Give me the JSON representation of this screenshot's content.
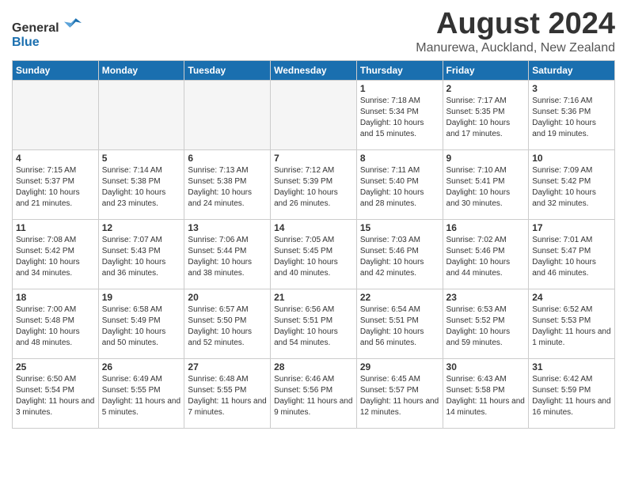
{
  "header": {
    "logo_general": "General",
    "logo_blue": "Blue",
    "month": "August 2024",
    "location": "Manurewa, Auckland, New Zealand"
  },
  "weekdays": [
    "Sunday",
    "Monday",
    "Tuesday",
    "Wednesday",
    "Thursday",
    "Friday",
    "Saturday"
  ],
  "weeks": [
    [
      {
        "day": "",
        "empty": true
      },
      {
        "day": "",
        "empty": true
      },
      {
        "day": "",
        "empty": true
      },
      {
        "day": "",
        "empty": true
      },
      {
        "day": "1",
        "sunrise": "7:18 AM",
        "sunset": "5:34 PM",
        "daylight": "10 hours and 15 minutes."
      },
      {
        "day": "2",
        "sunrise": "7:17 AM",
        "sunset": "5:35 PM",
        "daylight": "10 hours and 17 minutes."
      },
      {
        "day": "3",
        "sunrise": "7:16 AM",
        "sunset": "5:36 PM",
        "daylight": "10 hours and 19 minutes."
      }
    ],
    [
      {
        "day": "4",
        "sunrise": "7:15 AM",
        "sunset": "5:37 PM",
        "daylight": "10 hours and 21 minutes."
      },
      {
        "day": "5",
        "sunrise": "7:14 AM",
        "sunset": "5:38 PM",
        "daylight": "10 hours and 23 minutes."
      },
      {
        "day": "6",
        "sunrise": "7:13 AM",
        "sunset": "5:38 PM",
        "daylight": "10 hours and 24 minutes."
      },
      {
        "day": "7",
        "sunrise": "7:12 AM",
        "sunset": "5:39 PM",
        "daylight": "10 hours and 26 minutes."
      },
      {
        "day": "8",
        "sunrise": "7:11 AM",
        "sunset": "5:40 PM",
        "daylight": "10 hours and 28 minutes."
      },
      {
        "day": "9",
        "sunrise": "7:10 AM",
        "sunset": "5:41 PM",
        "daylight": "10 hours and 30 minutes."
      },
      {
        "day": "10",
        "sunrise": "7:09 AM",
        "sunset": "5:42 PM",
        "daylight": "10 hours and 32 minutes."
      }
    ],
    [
      {
        "day": "11",
        "sunrise": "7:08 AM",
        "sunset": "5:42 PM",
        "daylight": "10 hours and 34 minutes."
      },
      {
        "day": "12",
        "sunrise": "7:07 AM",
        "sunset": "5:43 PM",
        "daylight": "10 hours and 36 minutes."
      },
      {
        "day": "13",
        "sunrise": "7:06 AM",
        "sunset": "5:44 PM",
        "daylight": "10 hours and 38 minutes."
      },
      {
        "day": "14",
        "sunrise": "7:05 AM",
        "sunset": "5:45 PM",
        "daylight": "10 hours and 40 minutes."
      },
      {
        "day": "15",
        "sunrise": "7:03 AM",
        "sunset": "5:46 PM",
        "daylight": "10 hours and 42 minutes."
      },
      {
        "day": "16",
        "sunrise": "7:02 AM",
        "sunset": "5:46 PM",
        "daylight": "10 hours and 44 minutes."
      },
      {
        "day": "17",
        "sunrise": "7:01 AM",
        "sunset": "5:47 PM",
        "daylight": "10 hours and 46 minutes."
      }
    ],
    [
      {
        "day": "18",
        "sunrise": "7:00 AM",
        "sunset": "5:48 PM",
        "daylight": "10 hours and 48 minutes."
      },
      {
        "day": "19",
        "sunrise": "6:58 AM",
        "sunset": "5:49 PM",
        "daylight": "10 hours and 50 minutes."
      },
      {
        "day": "20",
        "sunrise": "6:57 AM",
        "sunset": "5:50 PM",
        "daylight": "10 hours and 52 minutes."
      },
      {
        "day": "21",
        "sunrise": "6:56 AM",
        "sunset": "5:51 PM",
        "daylight": "10 hours and 54 minutes."
      },
      {
        "day": "22",
        "sunrise": "6:54 AM",
        "sunset": "5:51 PM",
        "daylight": "10 hours and 56 minutes."
      },
      {
        "day": "23",
        "sunrise": "6:53 AM",
        "sunset": "5:52 PM",
        "daylight": "10 hours and 59 minutes."
      },
      {
        "day": "24",
        "sunrise": "6:52 AM",
        "sunset": "5:53 PM",
        "daylight": "11 hours and 1 minute."
      }
    ],
    [
      {
        "day": "25",
        "sunrise": "6:50 AM",
        "sunset": "5:54 PM",
        "daylight": "11 hours and 3 minutes."
      },
      {
        "day": "26",
        "sunrise": "6:49 AM",
        "sunset": "5:55 PM",
        "daylight": "11 hours and 5 minutes."
      },
      {
        "day": "27",
        "sunrise": "6:48 AM",
        "sunset": "5:55 PM",
        "daylight": "11 hours and 7 minutes."
      },
      {
        "day": "28",
        "sunrise": "6:46 AM",
        "sunset": "5:56 PM",
        "daylight": "11 hours and 9 minutes."
      },
      {
        "day": "29",
        "sunrise": "6:45 AM",
        "sunset": "5:57 PM",
        "daylight": "11 hours and 12 minutes."
      },
      {
        "day": "30",
        "sunrise": "6:43 AM",
        "sunset": "5:58 PM",
        "daylight": "11 hours and 14 minutes."
      },
      {
        "day": "31",
        "sunrise": "6:42 AM",
        "sunset": "5:59 PM",
        "daylight": "11 hours and 16 minutes."
      }
    ]
  ]
}
